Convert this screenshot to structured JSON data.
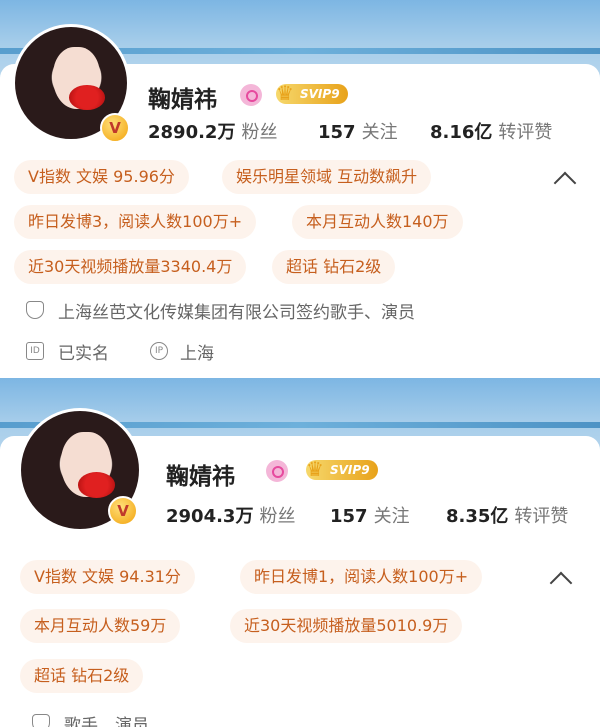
{
  "profiles": [
    {
      "name": "鞠婧祎",
      "svip_label": "SVIP9",
      "stats": [
        {
          "value": "2890.2万",
          "label": "粉丝"
        },
        {
          "value": "157",
          "label": "关注"
        },
        {
          "value": "8.16亿",
          "label": "转评赞"
        }
      ],
      "tags": [
        "V指数 文娱 95.96分",
        "娱乐明星领域 互动数飙升",
        "昨日发博3，阅读人数100万+",
        "本月互动人数140万",
        "近30天视频播放量3340.4万",
        "超话 钻石2级"
      ],
      "verification": "上海丝芭文化传媒集团有限公司签约歌手、演员",
      "realname": "已实名",
      "ip_location": "上海"
    },
    {
      "name": "鞠婧祎",
      "svip_label": "SVIP9",
      "stats": [
        {
          "value": "2904.3万",
          "label": "粉丝"
        },
        {
          "value": "157",
          "label": "关注"
        },
        {
          "value": "8.35亿",
          "label": "转评赞"
        }
      ],
      "tags": [
        "V指数 文娱 94.31分",
        "昨日发博1，阅读人数100万+",
        "本月互动人数59万",
        "近30天视频播放量5010.9万",
        "超话 钻石2级"
      ],
      "verification": "歌手、演员"
    }
  ],
  "icons": {
    "v_badge": "V",
    "crown": "♛",
    "idcard": "ID",
    "ip": "IP"
  },
  "colors": {
    "tag_bg": "#fdf3ec",
    "tag_text": "#c65f1e",
    "svip_gold": "#e8a21a",
    "weibo_pink": "#e64a9e"
  }
}
